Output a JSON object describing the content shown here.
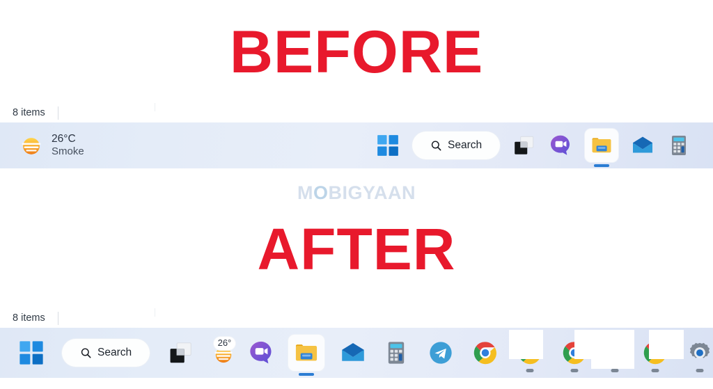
{
  "captions": {
    "before": "BEFORE",
    "after": "AFTER",
    "accent_color": "#e8192c"
  },
  "watermark": {
    "text_left": "M",
    "text_o": "O",
    "text_right": "BIGYAAN",
    "full": "MOBIGYAAN",
    "color": "#d5dfec"
  },
  "status_bars": {
    "top": {
      "items_text": "8 items"
    },
    "bottom": {
      "items_text": "8 items"
    }
  },
  "taskbar_before": {
    "background_colors": [
      "#dfe8f6",
      "#e8eef9",
      "#d9e2f4"
    ],
    "weather": {
      "icon": "sun-haze-icon",
      "temperature": "26°C",
      "condition": "Smoke"
    },
    "items": [
      {
        "name": "start-button",
        "icon": "windows-logo-icon",
        "label": "Start",
        "active": false,
        "running": false
      },
      {
        "name": "search-pill",
        "icon": "search-icon",
        "label": "Search",
        "active": false,
        "running": false
      },
      {
        "name": "task-view-button",
        "icon": "task-view-icon",
        "label": "Task View",
        "active": false,
        "running": false
      },
      {
        "name": "chat-button",
        "icon": "chat-teams-icon",
        "label": "Chat",
        "active": false,
        "running": false
      },
      {
        "name": "file-explorer-button",
        "icon": "file-explorer-icon",
        "label": "File Explorer",
        "active": true,
        "running": true
      },
      {
        "name": "mail-button",
        "icon": "mail-icon",
        "label": "Mail",
        "active": false,
        "running": false
      },
      {
        "name": "calculator-button",
        "icon": "calculator-icon",
        "label": "Calculator",
        "active": false,
        "running": false
      }
    ]
  },
  "taskbar_after": {
    "background_colors": [
      "#dfe8f6",
      "#e8eef9",
      "#d9e2f4"
    ],
    "weather": {
      "icon": "sun-haze-icon",
      "badge": "26°"
    },
    "items": [
      {
        "name": "start-button",
        "icon": "windows-logo-icon",
        "label": "Start",
        "active": false,
        "running": false
      },
      {
        "name": "search-pill",
        "icon": "search-icon",
        "label": "Search",
        "active": false,
        "running": false
      },
      {
        "name": "task-view-button",
        "icon": "task-view-icon",
        "label": "Task View",
        "active": false,
        "running": false
      },
      {
        "name": "weather-widget",
        "icon": "sun-haze-icon",
        "label": "26°",
        "active": false,
        "running": false
      },
      {
        "name": "chat-button",
        "icon": "chat-teams-icon",
        "label": "Chat",
        "active": false,
        "running": false
      },
      {
        "name": "file-explorer-button",
        "icon": "file-explorer-icon",
        "label": "File Explorer",
        "active": true,
        "running": true
      },
      {
        "name": "mail-button",
        "icon": "mail-icon",
        "label": "Mail",
        "active": false,
        "running": false
      },
      {
        "name": "calculator-button",
        "icon": "calculator-icon",
        "label": "Calculator",
        "active": false,
        "running": false
      },
      {
        "name": "telegram-button",
        "icon": "telegram-icon",
        "label": "Telegram",
        "active": false,
        "running": false
      },
      {
        "name": "chrome-button-1",
        "icon": "chrome-icon",
        "label": "Google Chrome",
        "active": false,
        "running": false
      },
      {
        "name": "chrome-button-2",
        "icon": "chrome-icon",
        "label": "Google Chrome",
        "active": false,
        "running": true
      },
      {
        "name": "chrome-button-3",
        "icon": "chrome-icon",
        "label": "Google Chrome",
        "active": false,
        "running": true
      },
      {
        "name": "redacted-button",
        "icon": "redacted-icon",
        "label": "",
        "active": false,
        "running": true
      },
      {
        "name": "chrome-button-4",
        "icon": "chrome-icon",
        "label": "Google Chrome",
        "active": false,
        "running": true
      },
      {
        "name": "settings-button",
        "icon": "settings-gear-icon",
        "label": "Settings",
        "active": false,
        "running": true
      }
    ]
  }
}
